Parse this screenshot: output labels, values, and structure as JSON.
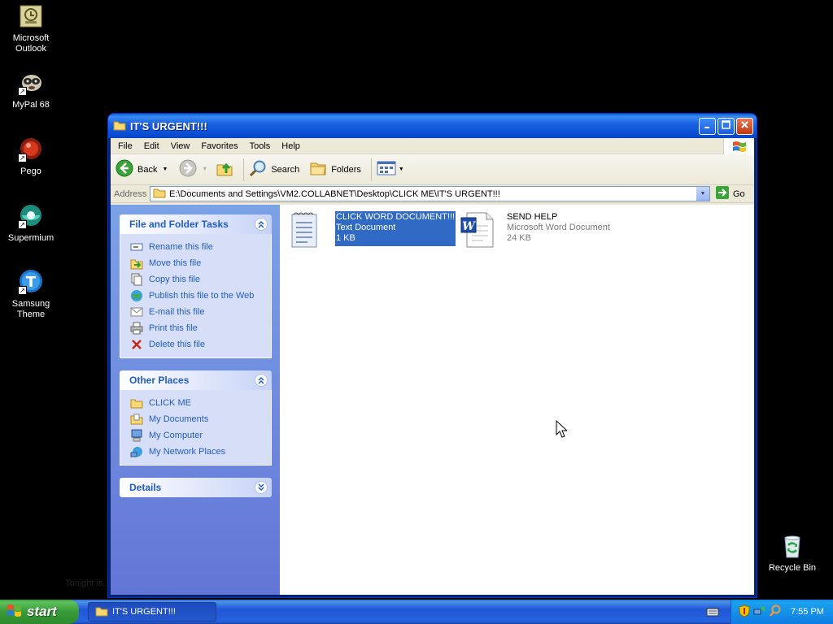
{
  "desktop": {
    "icons": [
      {
        "label": "Microsoft Outlook",
        "icon": "outlook-icon"
      },
      {
        "label": "MyPal 68",
        "icon": "mypal-icon"
      },
      {
        "label": "Pego",
        "icon": "pego-icon"
      },
      {
        "label": "Supermium",
        "icon": "supermium-icon"
      },
      {
        "label": "Samsung Theme",
        "icon": "samsung-theme-icon"
      },
      {
        "label": "Recycle Bin",
        "icon": "recycle-bin-icon"
      }
    ],
    "faint_text": "Tonight is..."
  },
  "window": {
    "title": "IT'S URGENT!!!",
    "menu": [
      "File",
      "Edit",
      "View",
      "Favorites",
      "Tools",
      "Help"
    ],
    "toolbar": {
      "back": "Back",
      "search": "Search",
      "folders": "Folders"
    },
    "address": {
      "label": "Address",
      "path": "E:\\Documents and Settings\\VM2.COLLABNET\\Desktop\\CLICK ME\\IT'S URGENT!!!",
      "go": "Go"
    },
    "task_pane": {
      "file_tasks": {
        "title": "File and Folder Tasks",
        "items": [
          {
            "label": "Rename this file",
            "icon": "rename-icon"
          },
          {
            "label": "Move this file",
            "icon": "move-icon"
          },
          {
            "label": "Copy this file",
            "icon": "copy-icon"
          },
          {
            "label": "Publish this file to the Web",
            "icon": "publish-web-icon"
          },
          {
            "label": "E-mail this file",
            "icon": "email-icon"
          },
          {
            "label": "Print this file",
            "icon": "print-icon"
          },
          {
            "label": "Delete this file",
            "icon": "delete-icon"
          }
        ]
      },
      "other_places": {
        "title": "Other Places",
        "items": [
          {
            "label": "CLICK ME",
            "icon": "folder-icon"
          },
          {
            "label": "My Documents",
            "icon": "my-documents-icon"
          },
          {
            "label": "My Computer",
            "icon": "my-computer-icon"
          },
          {
            "label": "My Network Places",
            "icon": "network-places-icon"
          }
        ]
      },
      "details": {
        "title": "Details"
      }
    },
    "files": [
      {
        "name": "CLICK WORD DOCUMENT!!!",
        "type": "Text Document",
        "size": "1 KB",
        "icon": "text-document-icon",
        "selected": true
      },
      {
        "name": "SEND HELP",
        "type": "Microsoft Word Document",
        "size": "24 KB",
        "icon": "word-document-icon",
        "selected": false
      }
    ]
  },
  "taskbar": {
    "start": "start",
    "active_task": "IT'S URGENT!!!",
    "clock": "7:55 PM"
  },
  "colors": {
    "titlebar": "#0a4fd6",
    "task_link": "#215dc6",
    "selection": "#316ac5",
    "start_green": "#379a37"
  }
}
